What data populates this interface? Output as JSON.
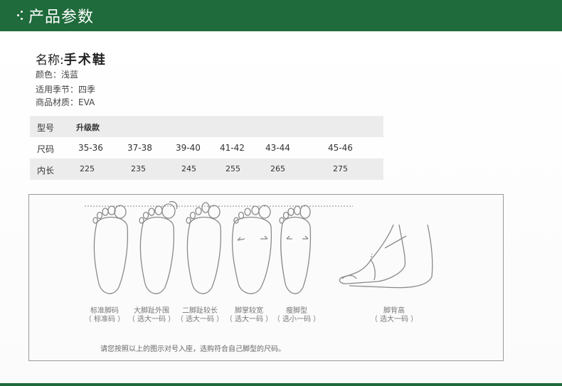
{
  "header": {
    "title": "产品参数"
  },
  "product": {
    "name_label": "名称:",
    "name_value": "手术鞋",
    "color": "颜色：浅蓝",
    "season": "适用季节：四季",
    "material": "商品材质：EVA"
  },
  "size_table": {
    "rows": [
      {
        "label": "型号",
        "cells": [
          "升级款"
        ]
      },
      {
        "label": "尺码",
        "cells": [
          "35-36",
          "37-38",
          "39-40",
          "41-42",
          "43-44",
          "45-46"
        ]
      },
      {
        "label": "内长",
        "cells": [
          "225",
          "235",
          "245",
          "255",
          "265",
          "275"
        ]
      }
    ]
  },
  "foot_guide": {
    "types": [
      {
        "name": "标准脚码",
        "advice": "（ 标准码 ）"
      },
      {
        "name": "大脚趾外围",
        "advice": "（ 选大一码 ）"
      },
      {
        "name": "二脚趾较长",
        "advice": "（ 选大一码 ）"
      },
      {
        "name": "脚掌较宽",
        "advice": "（ 选大一码 ）"
      },
      {
        "name": "瘦脚型",
        "advice": "（ 选小一码 ）"
      },
      {
        "name": "脚背高",
        "advice": "（ 选大一码 ）"
      }
    ],
    "note": "请您按照以上的图示对号入座，选购符合自己脚型的尺码。"
  },
  "colors": {
    "brand_green": "#1f6b3b",
    "table_shade": "#ececec"
  }
}
